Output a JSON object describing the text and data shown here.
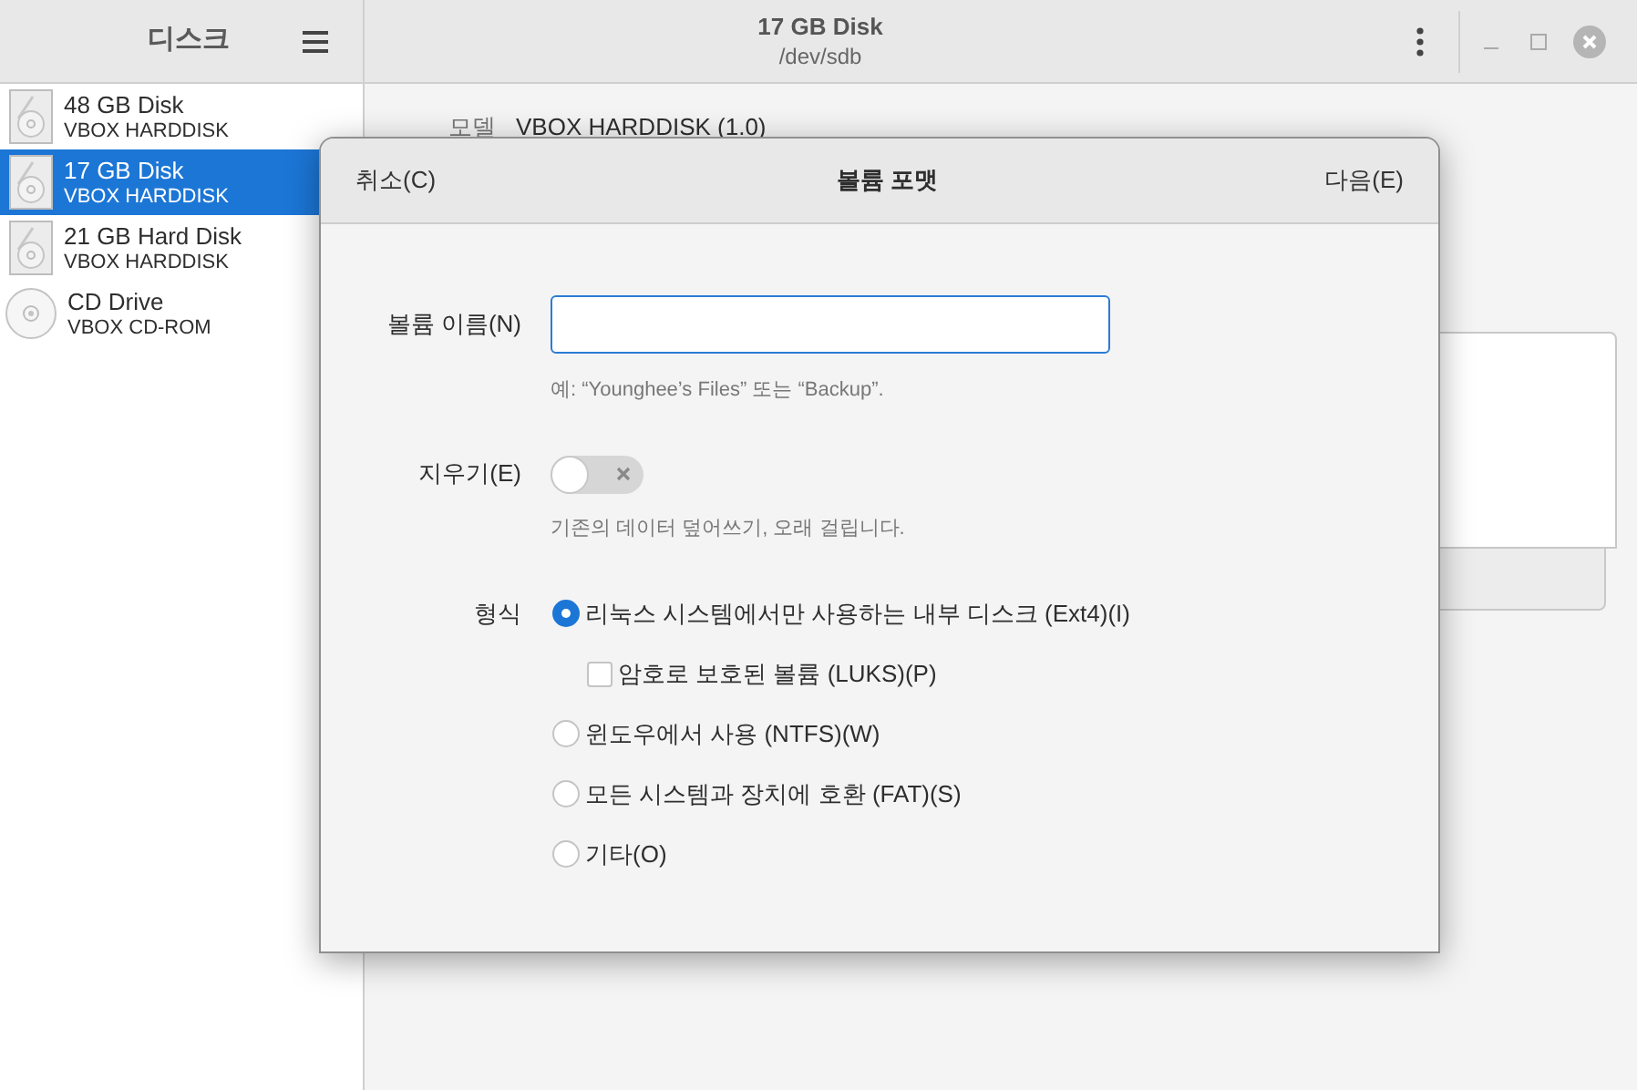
{
  "sidebar": {
    "title": "디스크",
    "disks": [
      {
        "name": "48 GB Disk",
        "model": "VBOX HARDDISK",
        "kind": "hdd",
        "selected": false
      },
      {
        "name": "17 GB Disk",
        "model": "VBOX HARDDISK",
        "kind": "hdd",
        "selected": true
      },
      {
        "name": "21 GB Hard Disk",
        "model": "VBOX HARDDISK",
        "kind": "hdd",
        "selected": false
      },
      {
        "name": "CD Drive",
        "model": "VBOX CD-ROM",
        "kind": "optical",
        "selected": false
      }
    ]
  },
  "header": {
    "title": "17 GB Disk",
    "subtitle": "/dev/sdb"
  },
  "details": [
    {
      "label": "모델",
      "value": "VBOX HARDDISK (1.0)"
    }
  ],
  "dialog": {
    "title": "볼륨 포맷",
    "cancel": "취소(C)",
    "next": "다음(E)",
    "name_label": "볼륨 이름(N)",
    "name_hint": "예: “Younghee’s Files” 또는 “Backup”.",
    "erase_label": "지우기(E)",
    "erase_on": false,
    "erase_hint": "기존의 데이터 덮어쓰기, 오래 걸립니다.",
    "type_label": "형식",
    "options": [
      {
        "kind": "radio",
        "label": "리눅스 시스템에서만 사용하는 내부 디스크 (Ext4)(I)",
        "selected": true
      },
      {
        "kind": "checkbox",
        "label": "암호로 보호된 볼륨 (LUKS)(P)",
        "checked": false
      },
      {
        "kind": "radio",
        "label": "윈도우에서 사용 (NTFS)(W)",
        "selected": false
      },
      {
        "kind": "radio",
        "label": "모든 시스템과 장치에 호환 (FAT)(S)",
        "selected": false
      },
      {
        "kind": "radio",
        "label": "기타(O)",
        "selected": false
      }
    ]
  }
}
